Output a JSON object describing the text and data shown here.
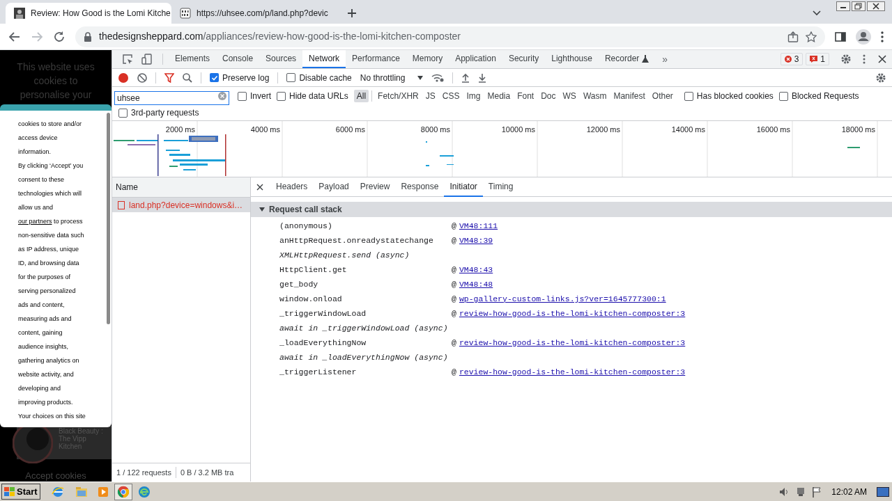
{
  "browser_tabs": [
    {
      "title": "Review: How Good is the Lomi Kitche",
      "selected": true,
      "kind": "photo"
    },
    {
      "title": "https://uhsee.com/p/land.php?devic",
      "selected": false,
      "kind": "binary"
    }
  ],
  "address_bar": {
    "host": "thedesignsheppard.com",
    "path": "/appliances/review-how-good-is-the-lomi-kitchen-composter"
  },
  "page": {
    "heading_lines": [
      "This website uses",
      "cookies to",
      "personalise your"
    ],
    "consent_lines": [
      {
        "text": "cookies to store and/or"
      },
      {
        "text": "access device"
      },
      {
        "text": "information."
      },
      {
        "text": "By clicking ‘Accept’ you"
      },
      {
        "text": "consent to these"
      },
      {
        "text": "technologies which will"
      },
      {
        "text": "allow us and"
      },
      {
        "link": "our partners",
        "text": " to process"
      },
      {
        "text": "non-sensitive data such"
      },
      {
        "text": "as IP address, unique"
      },
      {
        "text": "ID, and browsing data"
      },
      {
        "text": "for the purposes of"
      },
      {
        "text": "serving personalized"
      },
      {
        "text": "ads and content,"
      },
      {
        "text": "measuring ads and"
      },
      {
        "text": "content, gaining"
      },
      {
        "text": "audience insights,"
      },
      {
        "text": "gathering analytics on"
      },
      {
        "text": "website activity, and"
      },
      {
        "text": "developing and"
      },
      {
        "text": "improving products."
      },
      {
        "text": "Your choices on this site"
      }
    ],
    "card_title_lines": [
      "Black Beauty :",
      "The Vipp",
      "Kitchen"
    ],
    "accept_button": "Accept cookies"
  },
  "devtools": {
    "panels": [
      {
        "label": "Elements",
        "selected": false
      },
      {
        "label": "Console",
        "selected": false
      },
      {
        "label": "Sources",
        "selected": false
      },
      {
        "label": "Network",
        "selected": true
      },
      {
        "label": "Performance",
        "selected": false
      },
      {
        "label": "Memory",
        "selected": false
      },
      {
        "label": "Application",
        "selected": false
      },
      {
        "label": "Security",
        "selected": false
      },
      {
        "label": "Lighthouse",
        "selected": false
      },
      {
        "label": "Recorder",
        "selected": false
      }
    ],
    "more": "»",
    "error_count": "3",
    "issue_count": "1",
    "toolbar": {
      "recording": true,
      "preserve_log": {
        "label": "Preserve log",
        "checked": true
      },
      "disable_cache": {
        "label": "Disable cache",
        "checked": false
      },
      "throttling": "No throttling"
    },
    "filter": {
      "value": "uhsee",
      "invert": {
        "label": "Invert",
        "checked": false
      },
      "hide_data_urls": {
        "label": "Hide data URLs",
        "checked": false
      },
      "types": [
        {
          "label": "All",
          "selected": true
        },
        {
          "label": "Fetch/XHR",
          "selected": false
        },
        {
          "label": "JS",
          "selected": false
        },
        {
          "label": "CSS",
          "selected": false
        },
        {
          "label": "Img",
          "selected": false
        },
        {
          "label": "Media",
          "selected": false
        },
        {
          "label": "Font",
          "selected": false
        },
        {
          "label": "Doc",
          "selected": false
        },
        {
          "label": "WS",
          "selected": false
        },
        {
          "label": "Wasm",
          "selected": false
        },
        {
          "label": "Manifest",
          "selected": false
        },
        {
          "label": "Other",
          "selected": false
        }
      ],
      "has_blocked_cookies": {
        "label": "Has blocked cookies",
        "checked": false
      },
      "blocked_requests": {
        "label": "Blocked Requests",
        "checked": false
      },
      "third_party": {
        "label": "3rd-party requests",
        "checked": false
      }
    },
    "overview": {
      "ticks": [
        "2000 ms",
        "4000 ms",
        "6000 ms",
        "8000 ms",
        "10000 ms",
        "12000 ms",
        "14000 ms",
        "16000 ms",
        "18000 ms"
      ]
    },
    "requests": {
      "column": "Name",
      "rows": [
        {
          "name": "land.php?device=windows&i…",
          "selected": true,
          "failed": true
        }
      ],
      "status": [
        "1 / 122 requests",
        "0 B / 3.2 MB tra"
      ]
    },
    "detail": {
      "tabs": [
        {
          "label": "Headers",
          "selected": false
        },
        {
          "label": "Payload",
          "selected": false
        },
        {
          "label": "Preview",
          "selected": false
        },
        {
          "label": "Response",
          "selected": false
        },
        {
          "label": "Initiator",
          "selected": true
        },
        {
          "label": "Timing",
          "selected": false
        }
      ],
      "section": {
        "title": "Request call stack",
        "expanded": true,
        "frames": [
          {
            "kind": "frame",
            "fn": "(anonymous)",
            "at": "@",
            "link": "VM48:111"
          },
          {
            "kind": "frame",
            "fn": "anHttpRequest.onreadystatechange",
            "at": "@",
            "link": "VM48:39"
          },
          {
            "kind": "async",
            "fn": "XMLHttpRequest.send (async)"
          },
          {
            "kind": "frame",
            "fn": "HttpClient.get",
            "at": "@",
            "link": "VM48:43"
          },
          {
            "kind": "frame",
            "fn": "get_body",
            "at": "@",
            "link": "VM48:48"
          },
          {
            "kind": "frame",
            "fn": "window.onload",
            "at": "@",
            "link": "wp-gallery-custom-links.js?ver=1645777300:1"
          },
          {
            "kind": "frame",
            "fn": "_triggerWindowLoad",
            "at": "@",
            "link": "review-how-good-is-the-lomi-kitchen-composter:3"
          },
          {
            "kind": "async",
            "fn": "await in _triggerWindowLoad (async)"
          },
          {
            "kind": "frame",
            "fn": "_loadEverythingNow",
            "at": "@",
            "link": "review-how-good-is-the-lomi-kitchen-composter:3"
          },
          {
            "kind": "async",
            "fn": "await in _loadEverythingNow (async)"
          },
          {
            "kind": "frame",
            "fn": "_triggerListener",
            "at": "@",
            "link": "review-how-good-is-the-lomi-kitchen-composter:3"
          }
        ]
      }
    }
  },
  "taskbar": {
    "start": "Start",
    "clock": "12:02 AM"
  }
}
